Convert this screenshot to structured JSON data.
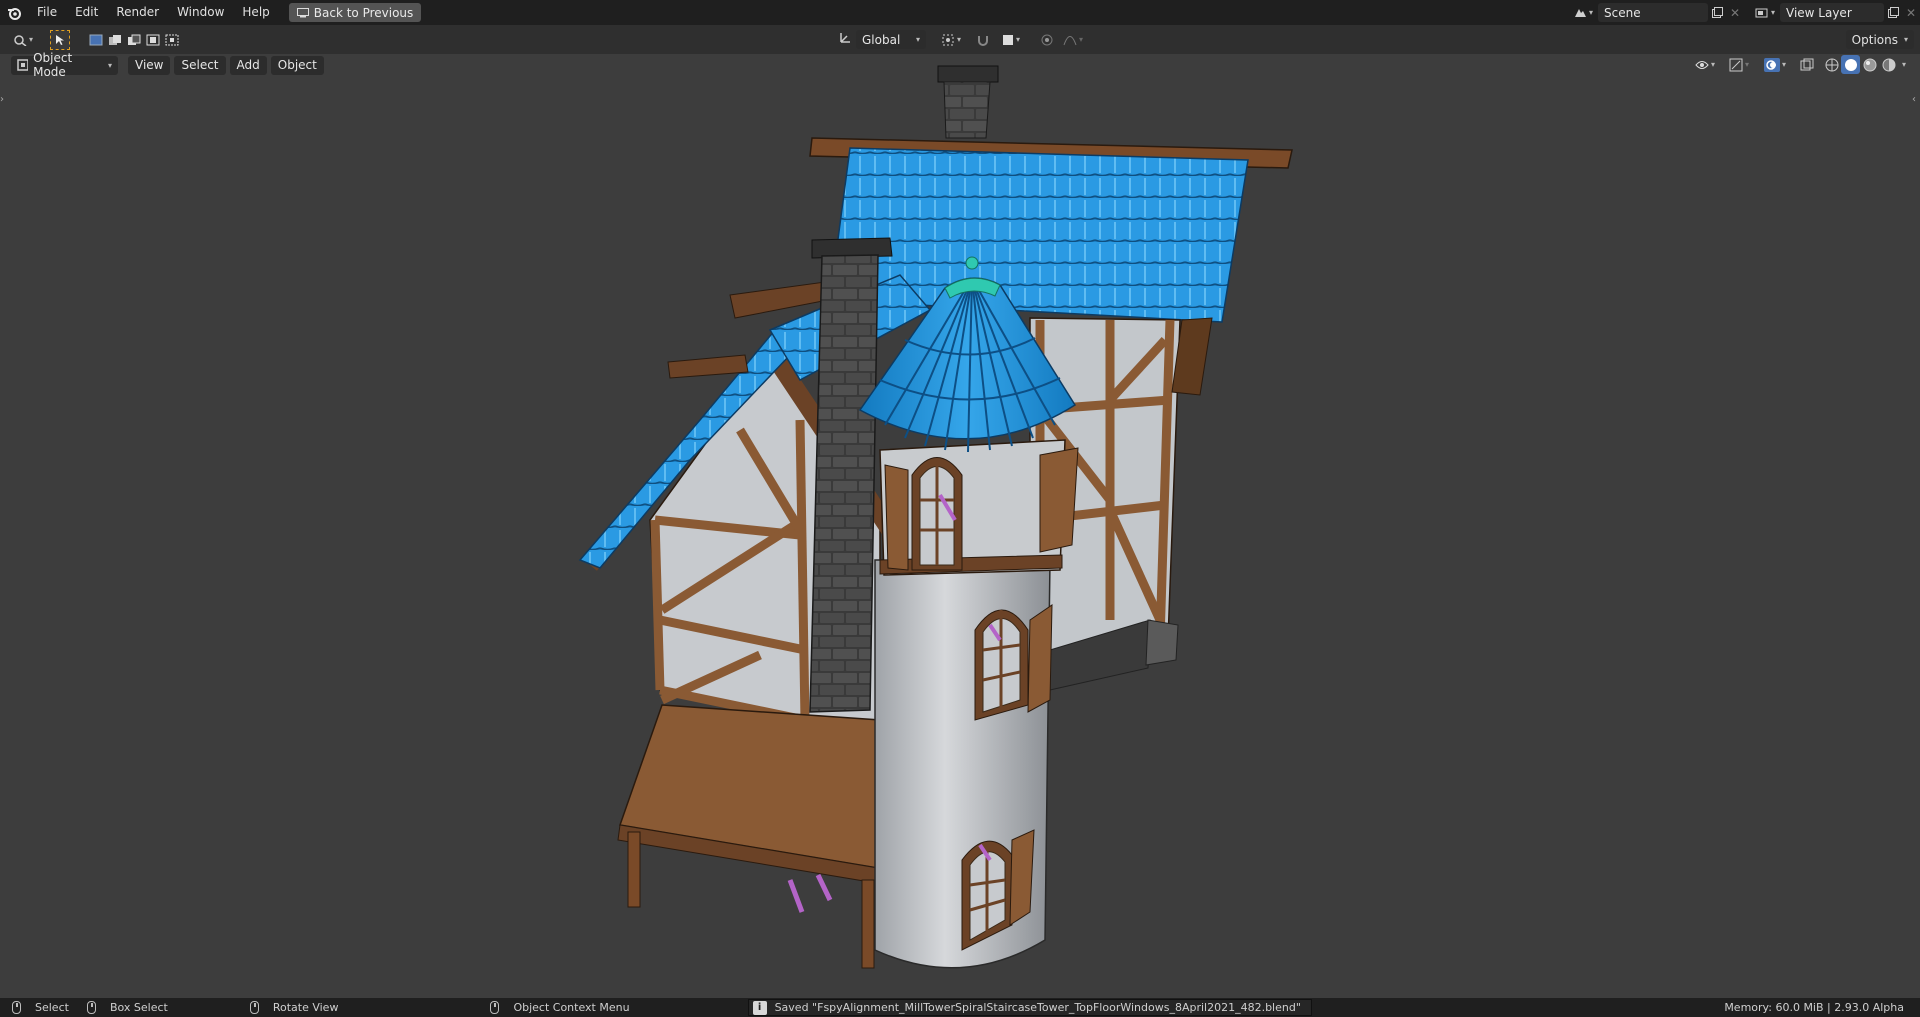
{
  "menubar": {
    "items": [
      "File",
      "Edit",
      "Render",
      "Window",
      "Help"
    ],
    "back_button": "Back to Previous"
  },
  "scene": {
    "label": "Scene"
  },
  "view_layer": {
    "label": "View Layer"
  },
  "toolbar": {
    "orientation": "Global",
    "options": "Options"
  },
  "viewport_header": {
    "mode": "Object Mode",
    "menus": [
      "View",
      "Select",
      "Add",
      "Object"
    ]
  },
  "statusbar": {
    "select": "Select",
    "box_select": "Box Select",
    "rotate_view": "Rotate View",
    "context_menu": "Object Context Menu",
    "saved": "Saved \"FspyAlignment_MillTowerSpiralStaircaseTower_TopFloorWindows_8April2021_482.blend\"",
    "memory": "Memory: 60.0 MiB | 2.93.0 Alpha"
  },
  "colors": {
    "roof_blue": "#1f8fd6",
    "wood_brown": "#8a5a34",
    "wall_white": "#c9ccd0",
    "stone_dark": "#4a4a4a",
    "finial_teal": "#2fc9b0"
  }
}
